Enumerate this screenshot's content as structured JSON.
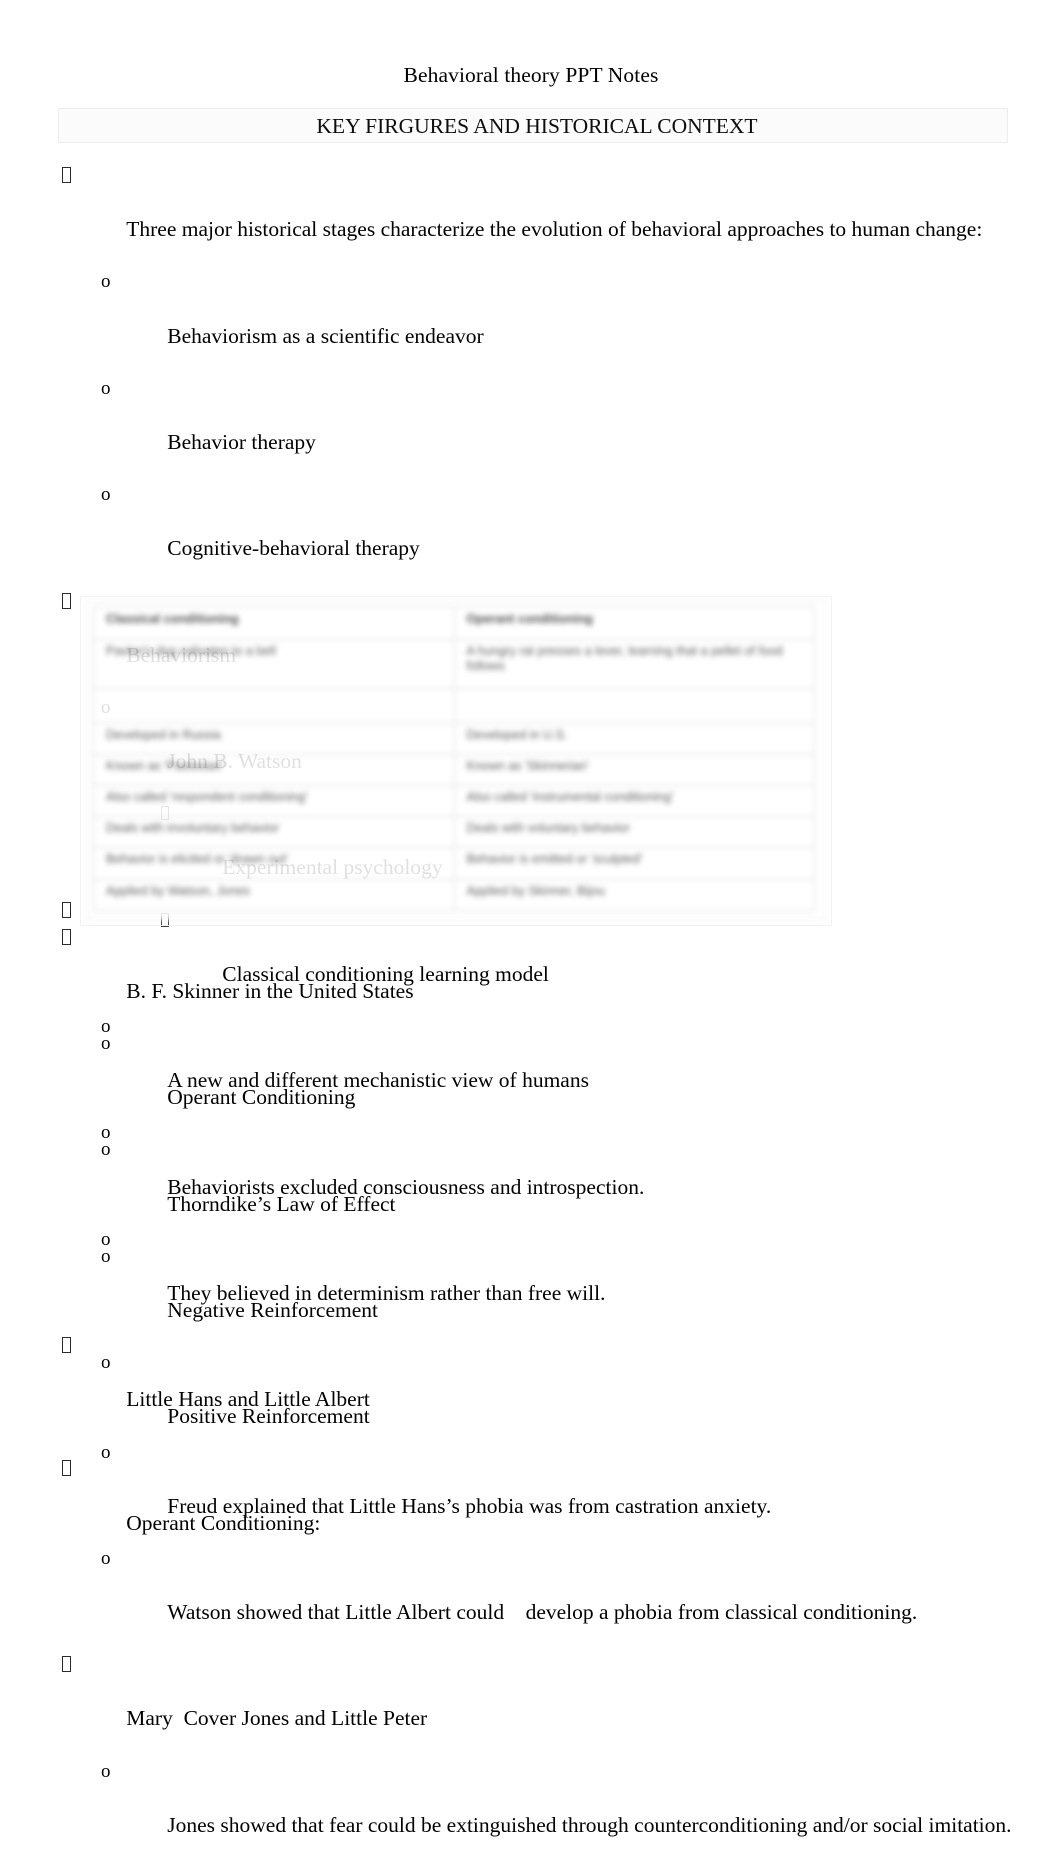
{
  "document": {
    "title": "Behavioral theory PPT Notes",
    "heading": "KEY FIRGURES AND HISTORICAL CONTEXT"
  },
  "outline": [
    {
      "level": 1,
      "bullet": "tofu-box-bullet",
      "text": "Three major historical stages characterize the evolution of behavioral approaches to human change:"
    },
    {
      "level": 2,
      "bullet": "o",
      "text": "Behaviorism as a scientific endeavor"
    },
    {
      "level": 2,
      "bullet": "o",
      "text": "Behavior therapy"
    },
    {
      "level": 2,
      "bullet": "o",
      "text": "Cognitive-behavioral therapy"
    },
    {
      "level": 1,
      "bullet": "tofu-box-bullet",
      "text": "Behaviorism"
    },
    {
      "level": 2,
      "bullet": "o",
      "text": "John B. Watson"
    },
    {
      "level": 3,
      "bullet": "tofu-box-bullet",
      "text": "Experimental psychology"
    },
    {
      "level": 3,
      "bullet": "tofu-box-bullet",
      "text": "Classical conditioning learning model"
    },
    {
      "level": 2,
      "bullet": "o",
      "text": "A new and different mechanistic view of humans"
    },
    {
      "level": 2,
      "bullet": "o",
      "text": "Behaviorists excluded consciousness and introspection."
    },
    {
      "level": 2,
      "bullet": "o",
      "text": "They believed in determinism rather than free will."
    },
    {
      "level": 1,
      "bullet": "tofu-box-bullet",
      "text": "Little Hans and Little Albert"
    },
    {
      "level": 2,
      "bullet": "o",
      "text": "Freud explained that Little Hans’s phobia was from castration anxiety."
    },
    {
      "level": 2,
      "bullet": "o",
      "text": "Watson showed that Little Albert could    develop a phobia from classical conditioning."
    },
    {
      "level": 1,
      "bullet": "tofu-box-bullet",
      "text": "Mary  Cover Jones and Little Peter"
    },
    {
      "level": 2,
      "bullet": "o",
      "text": "Jones showed that fear could be extinguished through counterconditioning and/or social imitation."
    }
  ],
  "outline_after_figure": [
    {
      "level": 1,
      "bullet": "tofu-box-bullet",
      "text": ""
    },
    {
      "level": 1,
      "bullet": "tofu-box-bullet",
      "text": "B. F. Skinner in the United States"
    },
    {
      "level": 2,
      "bullet": "o",
      "text": "Operant Conditioning"
    },
    {
      "level": 2,
      "bullet": "o",
      "text": "Thorndike’s Law of Effect"
    },
    {
      "level": 2,
      "bullet": "o",
      "text": "Negative Reinforcement"
    },
    {
      "level": 2,
      "bullet": "o",
      "text": "Positive Reinforcement"
    },
    {
      "level": 1,
      "bullet": "tofu-box-bullet",
      "text": "Operant Conditioning:"
    }
  ],
  "figure": {
    "name": "conditioning-comparison-table",
    "rendering": "blurred-unreadable-scanned-image",
    "columns": 2,
    "rows": [
      {
        "left": "Classical conditioning",
        "right": "Operant conditioning"
      },
      {
        "left": "Pavlov's dog salivates to a bell",
        "right": "A hungry rat presses a lever, learning that a pellet of food follows"
      },
      {
        "left": "",
        "right": ""
      },
      {
        "left": "Developed in Russia",
        "right": "Developed in U.S."
      },
      {
        "left": "Known as 'Pavlovian'",
        "right": "Known as 'Skinnerian'"
      },
      {
        "left": "Also called 'respondent conditioning'",
        "right": "Also called 'instrumental conditioning'"
      },
      {
        "left": "Deals with involuntary behavior",
        "right": "Deals with voluntary behavior"
      },
      {
        "left": "Behavior is elicited or 'drawn out'",
        "right": "Behavior is emitted or 'sculpted'"
      },
      {
        "left": "Applied by Watson, Jones",
        "right": "Applied by Skinner, Bijou"
      }
    ]
  },
  "colors": {
    "page_background": "#ffffff",
    "text": "#000000",
    "heading_box_border": "#ededed",
    "heading_box_fill": "#fbfbfb",
    "table_border": "#dcdcdc"
  }
}
